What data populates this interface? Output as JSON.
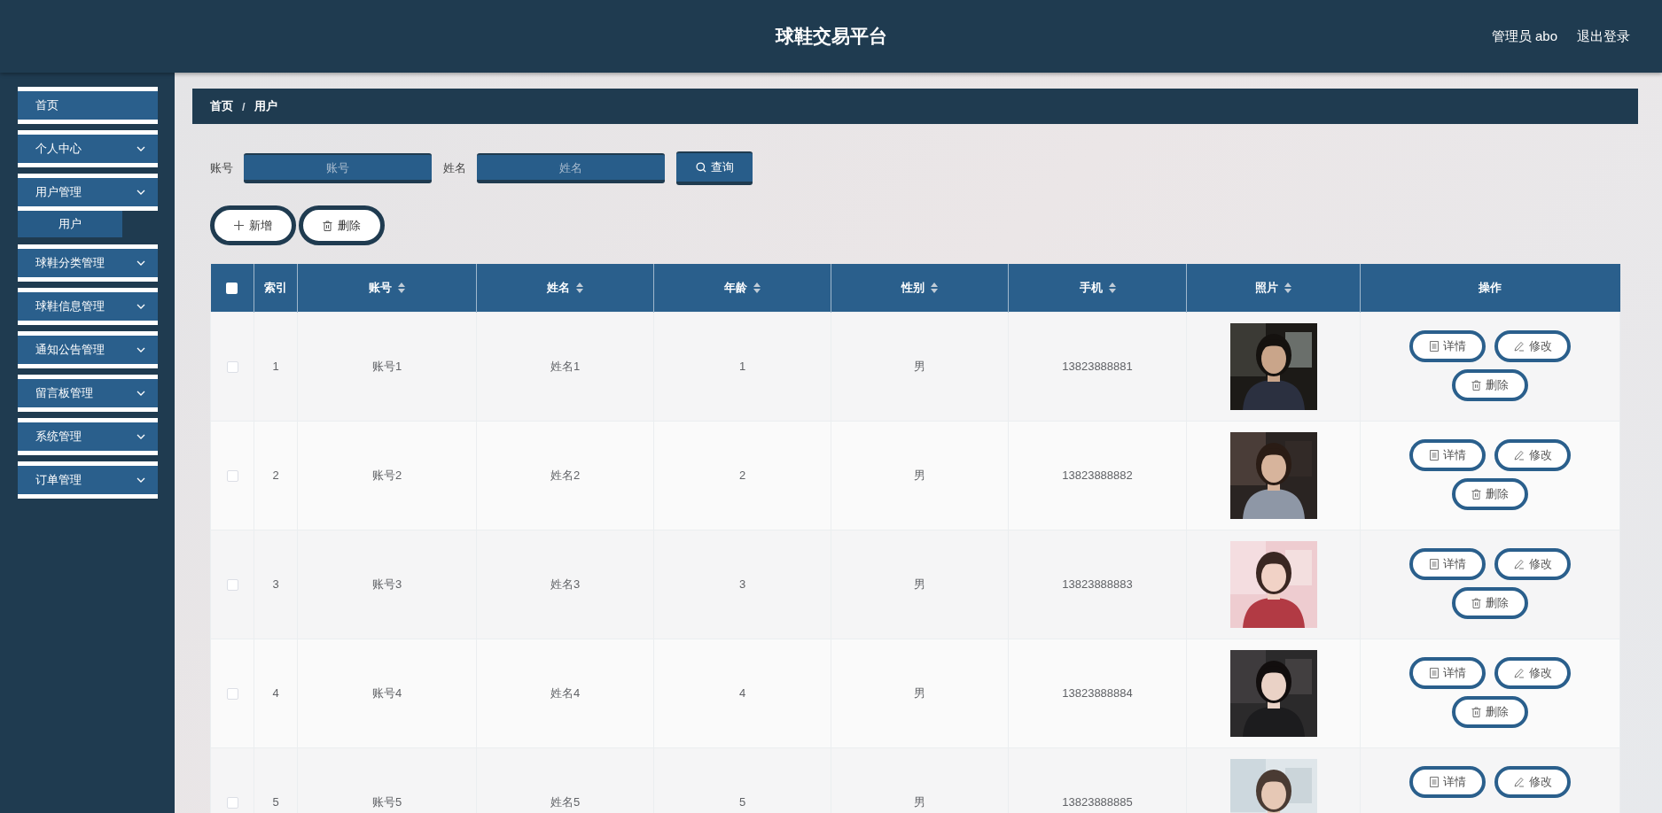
{
  "header": {
    "title": "球鞋交易平台",
    "user": "管理员 abo",
    "logout": "退出登录"
  },
  "sidebar": {
    "items": [
      {
        "label": "首页",
        "kind": "link"
      },
      {
        "label": "个人中心",
        "kind": "menu"
      },
      {
        "label": "用户管理",
        "kind": "menu",
        "children": [
          {
            "label": "用户"
          }
        ]
      },
      {
        "label": "球鞋分类管理",
        "kind": "menu"
      },
      {
        "label": "球鞋信息管理",
        "kind": "menu"
      },
      {
        "label": "通知公告管理",
        "kind": "menu"
      },
      {
        "label": "留言板管理",
        "kind": "menu"
      },
      {
        "label": "系统管理",
        "kind": "menu"
      },
      {
        "label": "订单管理",
        "kind": "menu"
      }
    ]
  },
  "breadcrumb": {
    "items": [
      "首页",
      "用户"
    ],
    "separator": "/"
  },
  "search": {
    "fields": [
      {
        "label": "账号",
        "placeholder": "账号"
      },
      {
        "label": "姓名",
        "placeholder": "姓名"
      }
    ],
    "button": "查询"
  },
  "toolbar": [
    {
      "kind": "add",
      "label": "新增"
    },
    {
      "kind": "delete",
      "label": "删除"
    }
  ],
  "table": {
    "select_all": {
      "checked": false
    },
    "columns": [
      {
        "label": "索引",
        "sortable": false
      },
      {
        "label": "账号",
        "sortable": true
      },
      {
        "label": "姓名",
        "sortable": true
      },
      {
        "label": "年龄",
        "sortable": true
      },
      {
        "label": "性别",
        "sortable": true
      },
      {
        "label": "手机",
        "sortable": true
      },
      {
        "label": "照片",
        "sortable": true
      },
      {
        "label": "操作",
        "sortable": false
      }
    ],
    "rows": [
      {
        "checked": false,
        "cells": [
          "1",
          "账号1",
          "姓名1",
          "1",
          "男",
          "13823888881"
        ],
        "photo": {
          "kind": "picture"
        },
        "actions": [
          {
            "kind": "detail",
            "label": "详情"
          },
          {
            "kind": "edit",
            "label": "修改"
          },
          {
            "kind": "delete",
            "label": "删除"
          }
        ]
      },
      {
        "checked": false,
        "cells": [
          "2",
          "账号2",
          "姓名2",
          "2",
          "男",
          "13823888882"
        ],
        "photo": {
          "kind": "picture"
        },
        "actions": [
          {
            "kind": "detail",
            "label": "详情"
          },
          {
            "kind": "edit",
            "label": "修改"
          },
          {
            "kind": "delete",
            "label": "删除"
          }
        ]
      },
      {
        "checked": false,
        "cells": [
          "3",
          "账号3",
          "姓名3",
          "3",
          "男",
          "13823888883"
        ],
        "photo": {
          "kind": "picture"
        },
        "actions": [
          {
            "kind": "detail",
            "label": "详情"
          },
          {
            "kind": "edit",
            "label": "修改"
          },
          {
            "kind": "delete",
            "label": "删除"
          }
        ]
      },
      {
        "checked": false,
        "cells": [
          "4",
          "账号4",
          "姓名4",
          "4",
          "男",
          "13823888884"
        ],
        "photo": {
          "kind": "picture"
        },
        "actions": [
          {
            "kind": "detail",
            "label": "详情"
          },
          {
            "kind": "edit",
            "label": "修改"
          },
          {
            "kind": "delete",
            "label": "删除"
          }
        ]
      },
      {
        "checked": false,
        "cells": [
          "5",
          "账号5",
          "姓名5",
          "5",
          "男",
          "13823888885"
        ],
        "photo": {
          "kind": "picture"
        },
        "actions": [
          {
            "kind": "detail",
            "label": "详情"
          },
          {
            "kind": "edit",
            "label": "修改"
          }
        ]
      }
    ]
  }
}
